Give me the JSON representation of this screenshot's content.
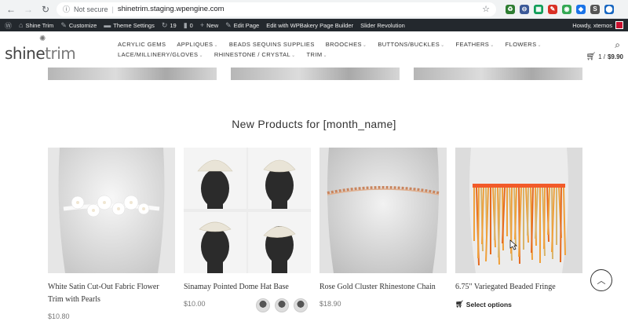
{
  "browser": {
    "security_label": "Not secure",
    "url": "shinetrim.staging.wpengine.com",
    "extensions": [
      {
        "name": "ext-1",
        "color": "#2e7d32",
        "glyph": "♻"
      },
      {
        "name": "ext-2",
        "color": "#3b5998",
        "glyph": "⊖"
      },
      {
        "name": "ext-3",
        "color": "#0f9d58",
        "glyph": "▦"
      },
      {
        "name": "ext-4",
        "color": "#d93025",
        "glyph": "✎"
      },
      {
        "name": "ext-5",
        "color": "#34a853",
        "glyph": "◉"
      },
      {
        "name": "ext-6",
        "color": "#1a73e8",
        "glyph": "◆"
      },
      {
        "name": "ext-7",
        "color": "#555555",
        "glyph": "S"
      },
      {
        "name": "ext-8",
        "color": "#1565c0",
        "glyph": "⬤"
      }
    ]
  },
  "wp_admin": {
    "site_name": "Shine Trim",
    "customize": "Customize",
    "theme_settings": "Theme Settings",
    "updates_count": "19",
    "comments_count": "0",
    "new": "New",
    "edit_page": "Edit Page",
    "wpbakery": "Edit with WPBakery Page Builder",
    "slider": "Slider Revolution",
    "howdy": "Howdy, xtemos"
  },
  "header": {
    "logo_shine": "shine",
    "logo_trim": "trim",
    "nav": [
      {
        "label": "ACRYLIC GEMS",
        "dropdown": ""
      },
      {
        "label": "APPLIQUES",
        "dropdown": "⌄"
      },
      {
        "label": "BEADS SEQUINS SUPPLIES",
        "dropdown": ""
      },
      {
        "label": "BROOCHES",
        "dropdown": "⌄"
      },
      {
        "label": "BUTTONS/BUCKLES",
        "dropdown": "⌄"
      },
      {
        "label": "FEATHERS",
        "dropdown": "⌄"
      },
      {
        "label": "FLOWERS",
        "dropdown": "⌄"
      },
      {
        "label": "LACE/MILLINERY/GLOVES",
        "dropdown": "⌄"
      },
      {
        "label": "RHINESTONE / CRYSTAL",
        "dropdown": "⌄"
      },
      {
        "label": "TRIM",
        "dropdown": "⌄"
      }
    ],
    "cart_count": "1 /",
    "cart_total": "$9.90"
  },
  "section": {
    "title": "New Products for [month_name]"
  },
  "products": [
    {
      "name": "White Satin Cut-Out Fabric Flower Trim with Pearls",
      "price": "$10.80"
    },
    {
      "name": "Sinamay Pointed Dome Hat Base",
      "price": "$10.00"
    },
    {
      "name": "Rose Gold Cluster Rhinestone Chain",
      "price": "$18.90"
    },
    {
      "name": "6.75\" Variegated Beaded Fringe",
      "action": "Select options"
    }
  ]
}
